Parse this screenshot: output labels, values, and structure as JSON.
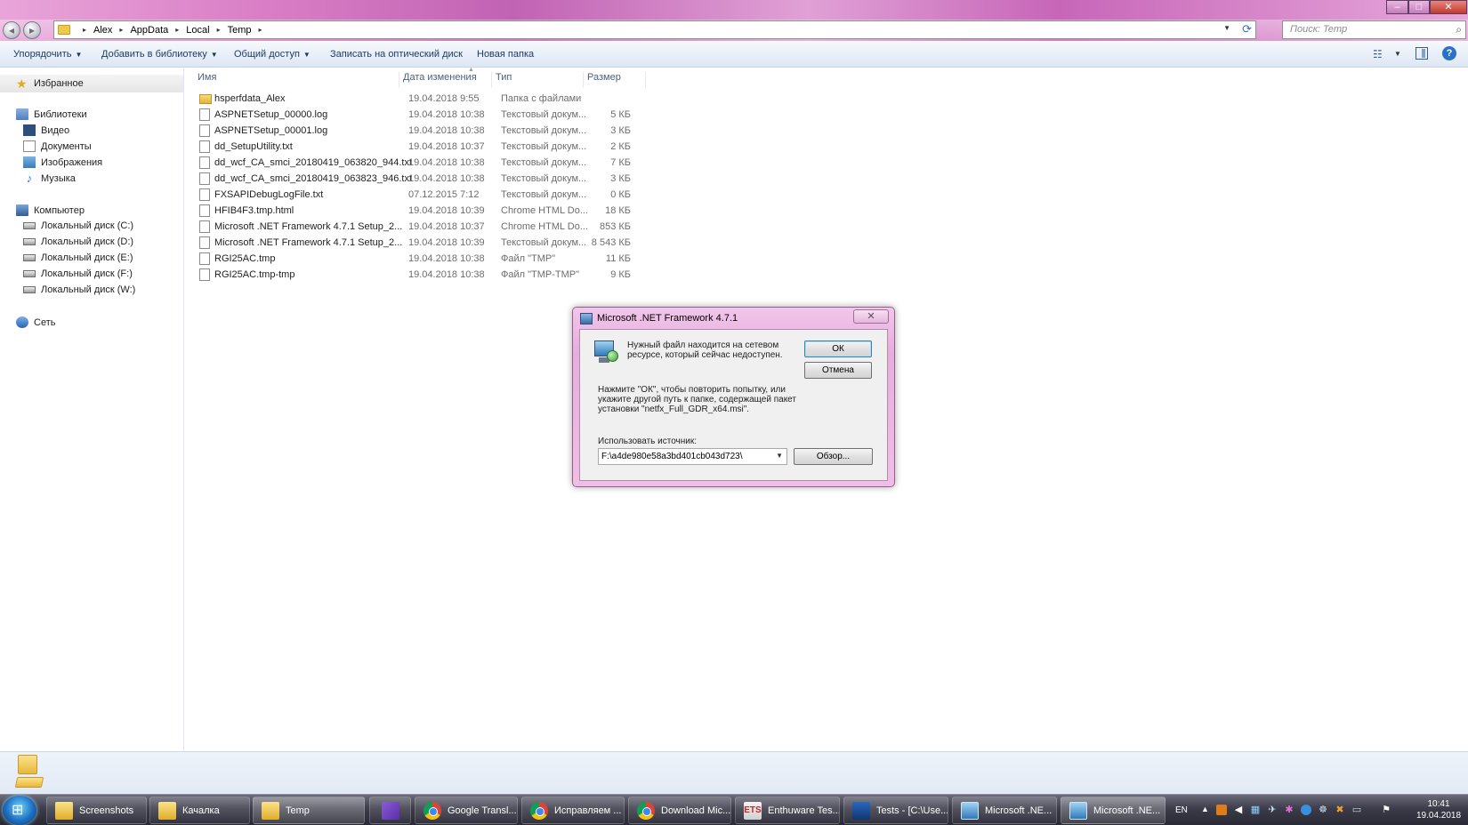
{
  "window": {
    "search_placeholder": "Поиск: Temp",
    "breadcrumbs": [
      "Alex",
      "AppData",
      "Local",
      "Temp"
    ]
  },
  "toolbar": {
    "organize": "Упорядочить",
    "add_to_library": "Добавить в библиотеку",
    "share": "Общий доступ",
    "burn": "Записать на оптический диск",
    "new_folder": "Новая папка"
  },
  "nav": {
    "favorites": "Избранное",
    "libraries": "Библиотеки",
    "video": "Видео",
    "documents": "Документы",
    "images": "Изображения",
    "music": "Музыка",
    "computer": "Компьютер",
    "drives": [
      "Локальный диск (C:)",
      "Локальный диск (D:)",
      "Локальный диск (E:)",
      "Локальный диск (F:)",
      "Локальный диск (W:)"
    ],
    "network": "Сеть"
  },
  "columns": {
    "name": "Имя",
    "date": "Дата изменения",
    "type": "Тип",
    "size": "Размер"
  },
  "files": [
    {
      "name": "hsperfdata_Alex",
      "date": "19.04.2018 9:55",
      "type": "Папка с файлами",
      "size": "",
      "folder": true
    },
    {
      "name": "ASPNETSetup_00000.log",
      "date": "19.04.2018 10:38",
      "type": "Текстовый докум...",
      "size": "5 КБ"
    },
    {
      "name": "ASPNETSetup_00001.log",
      "date": "19.04.2018 10:38",
      "type": "Текстовый докум...",
      "size": "3 КБ"
    },
    {
      "name": "dd_SetupUtility.txt",
      "date": "19.04.2018 10:37",
      "type": "Текстовый докум...",
      "size": "2 КБ"
    },
    {
      "name": "dd_wcf_CA_smci_20180419_063820_944.txt",
      "date": "19.04.2018 10:38",
      "type": "Текстовый докум...",
      "size": "7 КБ"
    },
    {
      "name": "dd_wcf_CA_smci_20180419_063823_946.txt",
      "date": "19.04.2018 10:38",
      "type": "Текстовый докум...",
      "size": "3 КБ"
    },
    {
      "name": "FXSAPIDebugLogFile.txt",
      "date": "07.12.2015 7:12",
      "type": "Текстовый докум...",
      "size": "0 КБ"
    },
    {
      "name": "HFIB4F3.tmp.html",
      "date": "19.04.2018 10:39",
      "type": "Chrome HTML Do...",
      "size": "18 КБ"
    },
    {
      "name": "Microsoft .NET Framework 4.7.1 Setup_2...",
      "date": "19.04.2018 10:37",
      "type": "Chrome HTML Do...",
      "size": "853 КБ"
    },
    {
      "name": "Microsoft .NET Framework 4.7.1 Setup_2...",
      "date": "19.04.2018 10:39",
      "type": "Текстовый докум...",
      "size": "8 543 КБ"
    },
    {
      "name": "RGI25AC.tmp",
      "date": "19.04.2018 10:38",
      "type": "Файл \"TMP\"",
      "size": "11 КБ"
    },
    {
      "name": "RGI25AC.tmp-tmp",
      "date": "19.04.2018 10:38",
      "type": "Файл \"TMP-TMP\"",
      "size": "9 КБ"
    }
  ],
  "dialog": {
    "title": "Microsoft .NET Framework 4.7.1",
    "message_line1": "Нужный файл находится на сетевом",
    "message_line2": "ресурсе, который сейчас недоступен.",
    "hint_line1": "Нажмите \"ОК\", чтобы повторить попытку, или",
    "hint_line2": "укажите другой путь к папке, содержащей пакет",
    "hint_line3": "установки \"netfx_Full_GDR_x64.msi\".",
    "source_label": "Использовать источник:",
    "source_value": "F:\\a4de980e58a3bd401cb043d723\\",
    "ok": "ОК",
    "cancel": "Отмена",
    "browse": "Обзор..."
  },
  "taskbar": {
    "items": [
      {
        "label": "Screenshots",
        "icon": "folder-icon"
      },
      {
        "label": "Качалка",
        "icon": "folder-icon"
      },
      {
        "label": "Temp",
        "icon": "folder-icon"
      },
      {
        "label": "",
        "icon": "visual-studio-icon"
      },
      {
        "label": "Google Transl...",
        "icon": "chrome-icon"
      },
      {
        "label": "Исправляем ...",
        "icon": "chrome-icon"
      },
      {
        "label": "Download Mic...",
        "icon": "chrome-icon"
      },
      {
        "label": "Enthuware Tes...",
        "icon": "ets-icon"
      },
      {
        "label": "Tests - [C:\\Use...",
        "icon": "intellij-icon"
      },
      {
        "label": "Microsoft .NE...",
        "icon": "dotnet-setup-icon"
      },
      {
        "label": "Microsoft .NE...",
        "icon": "dotnet-setup-icon"
      }
    ],
    "language": "EN",
    "time": "10:41",
    "date": "19.04.2018"
  }
}
